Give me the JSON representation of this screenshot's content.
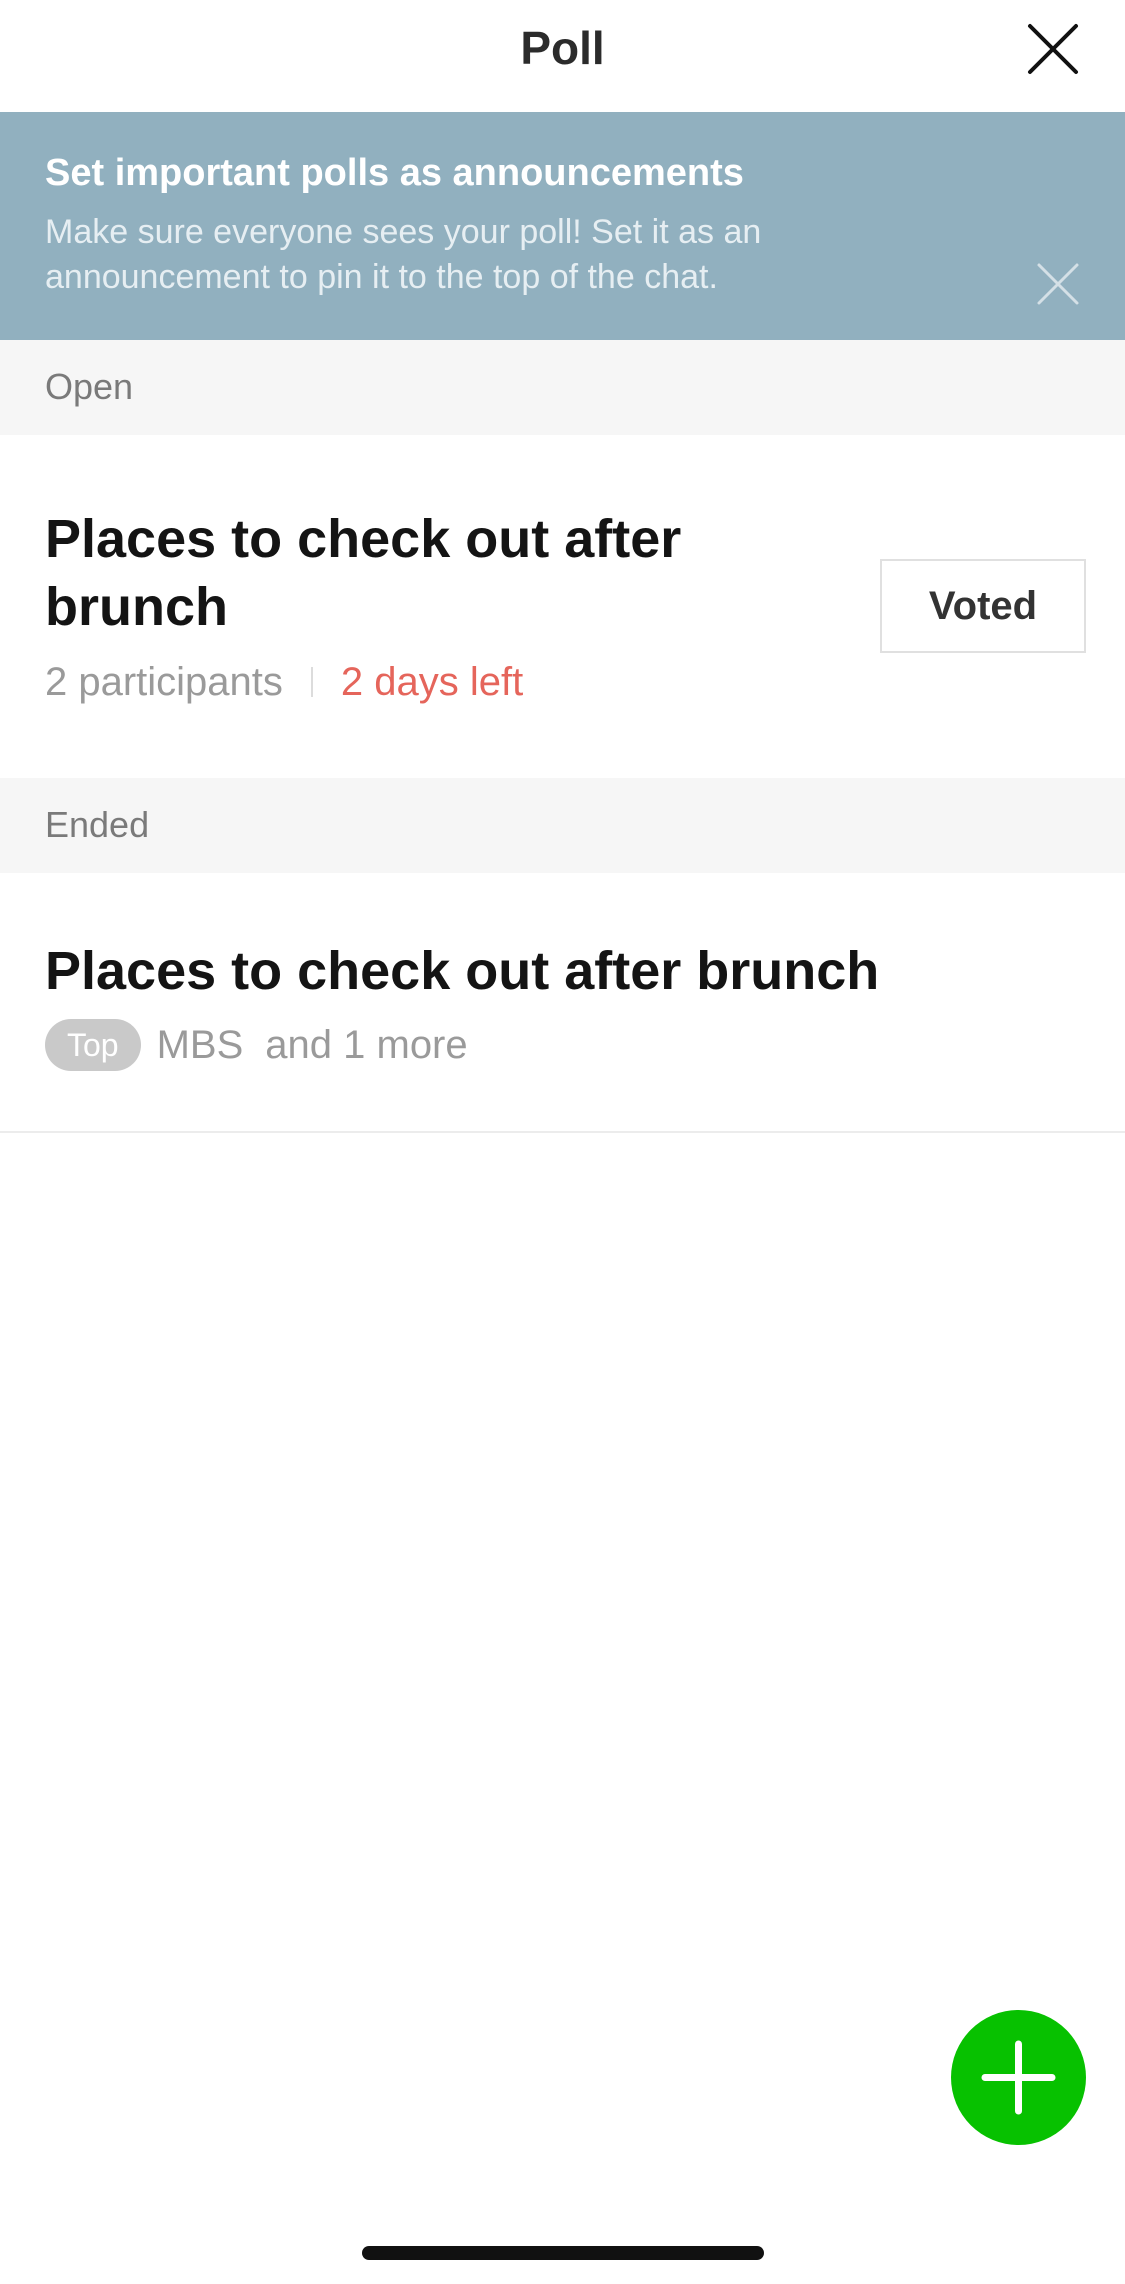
{
  "header": {
    "title": "Poll",
    "close_icon": "close-icon"
  },
  "banner": {
    "title": "Set important polls as announcements",
    "text": "Make sure everyone sees your poll! Set it as an announcement to pin it to the top of the chat.",
    "close_icon": "close-icon",
    "background_color": "#91b0bf"
  },
  "sections": {
    "open_label": "Open",
    "ended_label": "Ended"
  },
  "open_poll": {
    "title": "Places to check out after brunch",
    "participants": "2 participants",
    "deadline": "2 days left",
    "status_button": "Voted"
  },
  "ended_poll": {
    "title": "Places to check out after brunch",
    "badge": "Top",
    "author": "MBS",
    "more": "and 1 more"
  },
  "fab": {
    "icon": "plus-icon",
    "color": "#07c100"
  },
  "colors": {
    "deadline": "#e5655b",
    "muted_text": "#9a9a9a"
  }
}
